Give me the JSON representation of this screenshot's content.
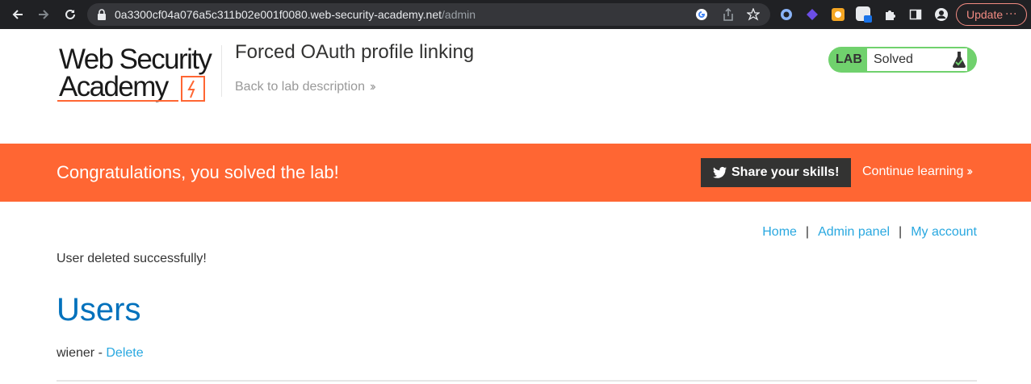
{
  "browser": {
    "url_host": "0a3300cf04a076a5c311b02e001f0080.web-security-academy.net",
    "url_path": "/admin",
    "update_label": "Update",
    "ext_badge": "0"
  },
  "header": {
    "logo_line1": "Web Security",
    "logo_line2": "Academy",
    "lab_title": "Forced OAuth profile linking",
    "back_link": "Back to lab description",
    "lab_label": "LAB",
    "status": "Solved"
  },
  "banner": {
    "message": "Congratulations, you solved the lab!",
    "share_label": "Share your skills!",
    "continue_label": "Continue learning"
  },
  "nav": {
    "home": "Home",
    "separator": "|",
    "admin_panel": "Admin panel",
    "my_account": "My account"
  },
  "content": {
    "message": "User deleted successfully!",
    "heading": "Users",
    "users": [
      {
        "name": "wiener",
        "separator": " - ",
        "action": "Delete"
      }
    ]
  },
  "colors": {
    "accent": "#ff6633",
    "link": "#29a8e0",
    "heading": "#0071bc",
    "solved": "#70d16d"
  }
}
